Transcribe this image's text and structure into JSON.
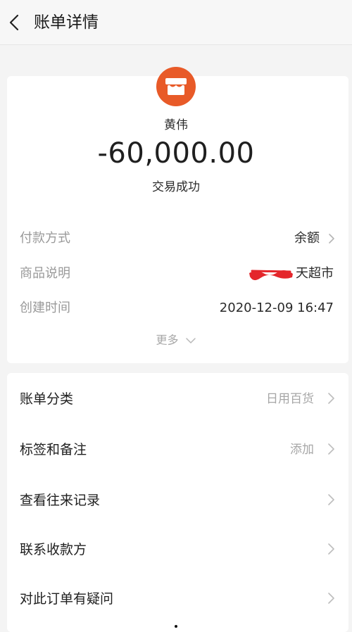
{
  "header": {
    "title": "账单详情",
    "back_icon": "chevron-left-icon"
  },
  "summary": {
    "shop_icon": "store-icon",
    "accent_color": "#e85a28",
    "payee": "黄伟",
    "amount": "-60,000.00",
    "status": "交易成功"
  },
  "details": {
    "payment_method_label": "付款方式",
    "payment_method_value": "余额",
    "description_label": "商品说明",
    "description_value": "天超市",
    "created_label": "创建时间",
    "created_value": "2020-12-09 16:47",
    "more_label": "更多"
  },
  "menu": {
    "category_label": "账单分类",
    "category_value": "日用百货",
    "tags_label": "标签和备注",
    "tags_value": "添加",
    "history_label": "查看往来记录",
    "contact_label": "联系收款方",
    "question_label": "对此订单有疑问"
  }
}
